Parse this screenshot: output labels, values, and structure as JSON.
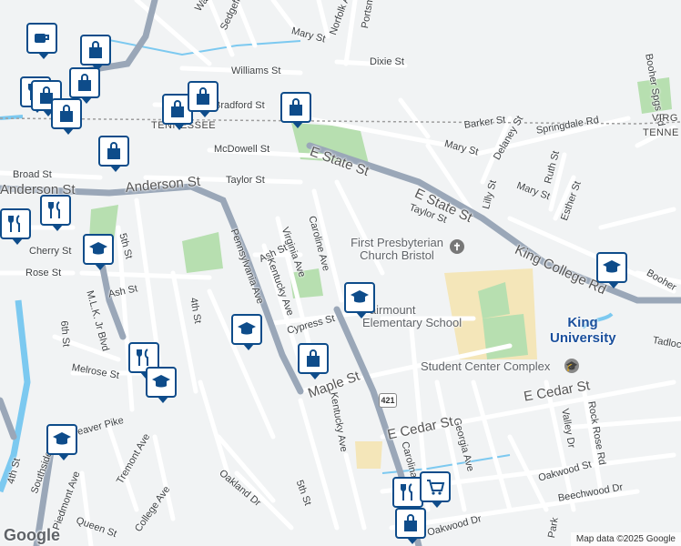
{
  "streets": [
    "Washington St",
    "Sedgefield St",
    "Mary St",
    "Norfolk Ave",
    "Portsmouth Pl",
    "Dixie St",
    "Williams St",
    "Bradford St",
    "Barker St",
    "McDowell St",
    "Broad St",
    "Taylor St",
    "Anderson St",
    "E State St",
    "Mary St",
    "Delaney St",
    "Springdale Rd",
    "Ruth St",
    "Lilly St",
    "Esther St",
    "Taylor St",
    "Mary St",
    "Booher Spgs Rd",
    "5th St",
    "Cherry St",
    "Rose St",
    "Ash St",
    "Ash St",
    "Virginia Ave",
    "Caroline Ave",
    "Kentucky Ave",
    "Pennsylvania Ave",
    "4th St",
    "Cypress St",
    "M.L.K. Jr Blvd",
    "6th St",
    "Melrose St",
    "Maple St",
    "E Cedar St",
    "E Cedar St",
    "Carolina Ave",
    "Georgia Ave",
    "Kentucky Ave",
    "Rock Rose Rd",
    "Valley Dr",
    "Tadlock",
    "King College Rd",
    "Oakland Dr",
    "5th St",
    "Tremont Ave",
    "College Ave",
    "Queen St",
    "Oakwood St",
    "Oakwood St",
    "Beechwood Dr",
    "Southside Ave",
    "Piedmont Ave",
    "Weaver Pike",
    "4th St",
    "5th St",
    "Oakwood Dr",
    "Park",
    "Booher"
  ],
  "poi": {
    "church": "First Presbyterian Church Bristol",
    "school": "Fairmount Elementary School",
    "university": "King University",
    "student_center": "Student Center Complex"
  },
  "state_line": {
    "left": "TENNESSEE",
    "right_top": "VIRG",
    "right_bottom": "TENNE"
  },
  "route_shield": "421",
  "attribution": "Map data ©2025 Google",
  "logo": "Google",
  "colors": {
    "road": "#ffffff",
    "major_road": "#9aa7b8",
    "park": "#b7dfb0",
    "campus": "#f4e6b9",
    "water": "#7cc9f0",
    "pin": "#0e4c8a"
  },
  "pins": [
    {
      "icon": "coffee-icon"
    },
    {
      "icon": "shopping-bag-icon"
    },
    {
      "icon": "shopping-bag-icon"
    },
    {
      "icon": "shopping-bag-icon"
    },
    {
      "icon": "shopping-bag-icon"
    },
    {
      "icon": "shopping-bag-icon"
    },
    {
      "icon": "shopping-bag-icon"
    },
    {
      "icon": "shopping-bag-icon"
    },
    {
      "icon": "restaurant-icon"
    },
    {
      "icon": "restaurant-icon"
    },
    {
      "icon": "school-icon"
    },
    {
      "icon": "school-icon"
    },
    {
      "icon": "school-icon"
    },
    {
      "icon": "school-icon"
    },
    {
      "icon": "school-icon"
    },
    {
      "icon": "restaurant-icon"
    },
    {
      "icon": "shopping-bag-icon"
    },
    {
      "icon": "restaurant-icon"
    },
    {
      "icon": "grocery-cart-icon"
    },
    {
      "icon": "shopping-bag-icon"
    },
    {
      "icon": "school-icon"
    }
  ]
}
